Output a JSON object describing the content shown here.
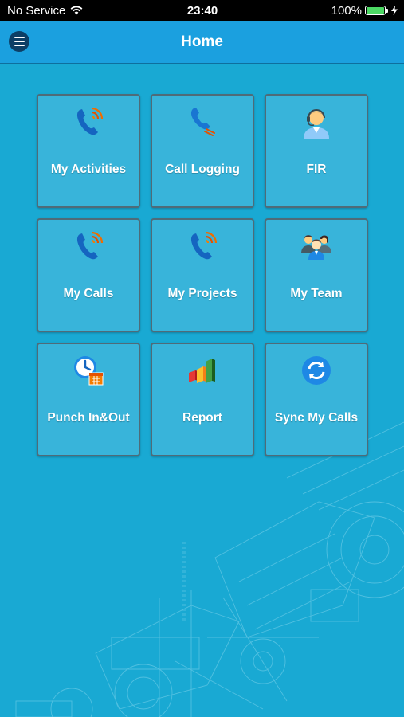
{
  "status": {
    "carrier": "No Service",
    "time": "23:40",
    "battery": "100%"
  },
  "header": {
    "title": "Home"
  },
  "tiles": [
    {
      "label": "My Activities",
      "icon": "phone-wave-icon"
    },
    {
      "label": "Call Logging",
      "icon": "phone-log-icon"
    },
    {
      "label": "FIR",
      "icon": "support-agent-icon"
    },
    {
      "label": "My Calls",
      "icon": "phone-wave-icon"
    },
    {
      "label": "My Projects",
      "icon": "phone-wave-icon"
    },
    {
      "label": "My Team",
      "icon": "team-icon"
    },
    {
      "label": "Punch In&Out",
      "icon": "clock-calendar-icon"
    },
    {
      "label": "Report",
      "icon": "bar-chart-icon"
    },
    {
      "label": "Sync My Calls",
      "icon": "sync-icon"
    }
  ],
  "colors": {
    "background": "#19a9d3",
    "header": "#1ba0df",
    "tile": "#38b4da",
    "tile_border": "#4f6b78"
  }
}
